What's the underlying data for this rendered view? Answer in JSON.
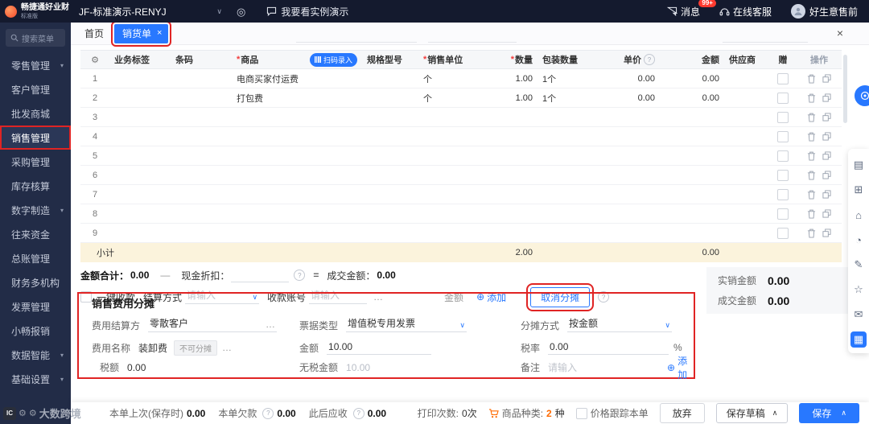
{
  "glyphs": {
    "gear": "⚙",
    "caret_down": "▾",
    "select_caret": "∨",
    "ellipsis": "…",
    "add": "⊕",
    "help": "?",
    "close": "×",
    "expand_up": "∧",
    "minus": "—",
    "equals": "=",
    "required": "*"
  },
  "topbar": {
    "logo_title": "畅捷通好业财",
    "logo_sub": "标准版",
    "org_select": "JF-标准演示-RENYJ",
    "demo_link": "我要看实例演示",
    "messages": {
      "label": "消息",
      "badge": "99+"
    },
    "support_label": "在线客服",
    "user_name": "好生意售前"
  },
  "sidebar": {
    "search_placeholder": "搜索菜单",
    "items": [
      {
        "label": "零售管理",
        "caret": true,
        "active": false,
        "annotated": false
      },
      {
        "label": "客户管理",
        "caret": false,
        "active": false,
        "annotated": false
      },
      {
        "label": "批发商城",
        "caret": false,
        "active": false,
        "annotated": false
      },
      {
        "label": "销售管理",
        "caret": false,
        "active": true,
        "annotated": true
      },
      {
        "label": "采购管理",
        "caret": false,
        "active": false,
        "annotated": false
      },
      {
        "label": "库存核算",
        "caret": false,
        "active": false,
        "annotated": false
      },
      {
        "label": "数字制造",
        "caret": true,
        "active": false,
        "annotated": false
      },
      {
        "label": "往来资金",
        "caret": false,
        "active": false,
        "annotated": false
      },
      {
        "label": "总账管理",
        "caret": false,
        "active": false,
        "annotated": false
      },
      {
        "label": "财务多机构",
        "caret": false,
        "active": false,
        "annotated": false
      },
      {
        "label": "发票管理",
        "caret": false,
        "active": false,
        "annotated": false
      },
      {
        "label": "小畅报销",
        "caret": false,
        "active": false,
        "annotated": false
      },
      {
        "label": "数据智能",
        "caret": true,
        "active": false,
        "annotated": false
      },
      {
        "label": "基础设置",
        "caret": true,
        "active": false,
        "annotated": false
      }
    ]
  },
  "tabs": {
    "home": "首页",
    "current": "销货单"
  },
  "grid": {
    "columns": [
      {
        "label": ""
      },
      {
        "label": "业务标签"
      },
      {
        "label": "条码"
      },
      {
        "label": "商品",
        "required": true,
        "scan_button": "扫码录入"
      },
      {
        "label": "规格型号"
      },
      {
        "label": "销售单位",
        "required": true
      },
      {
        "label": "数量",
        "required": true
      },
      {
        "label": "包装数量"
      },
      {
        "label": "单价",
        "info": true
      },
      {
        "label": "金额"
      },
      {
        "label": "供应商"
      },
      {
        "label": "赠"
      },
      {
        "label": "操作"
      }
    ],
    "rows": [
      {
        "rownum": "1",
        "product": "电商买家付运费",
        "unit": "个",
        "qty": "1.00",
        "pack": "1个",
        "price": "0.00",
        "amount": "0.00"
      },
      {
        "rownum": "2",
        "product": "打包费",
        "unit": "个",
        "qty": "1.00",
        "pack": "1个",
        "price": "0.00",
        "amount": "0.00"
      },
      {
        "rownum": "3"
      },
      {
        "rownum": "4"
      },
      {
        "rownum": "5"
      },
      {
        "rownum": "6"
      },
      {
        "rownum": "7"
      },
      {
        "rownum": "8"
      },
      {
        "rownum": "9"
      }
    ],
    "subtotal": {
      "label": "小计",
      "qty": "2.00",
      "amount": "0.00"
    }
  },
  "totals": {
    "amount_total_label": "金额合计：",
    "amount_total": "0.00",
    "cash_discount_label": "现金折扣：",
    "deal_amount_label": "成交金额：",
    "deal_amount": "0.00"
  },
  "payment": {
    "quick_receipt_label": "一键收款",
    "settle_method_label": "结算方式",
    "settle_method_placeholder": "请输入",
    "account_label": "收款账号",
    "account_placeholder": "请输入",
    "amount_label": "金额",
    "add_label": "添加",
    "cancel_allocation_label": "取消分摊"
  },
  "summary": {
    "actual_label": "实销金额",
    "actual_value": "0.00",
    "deal_label": "成交金额",
    "deal_value": "0.00"
  },
  "fee": {
    "title": "销售费用分摊",
    "payer_label": "费用结算方",
    "payer_value": "零散客户",
    "bill_type_label": "票据类型",
    "bill_type_value": "增值税专用发票",
    "allocate_label": "分摊方式",
    "allocate_value": "按金额",
    "fee_name_label": "费用名称",
    "fee_name_value": "装卸费",
    "fee_tag": "不可分摊",
    "amount_label": "金额",
    "amount_value": "10.00",
    "tax_rate_label": "税率",
    "tax_rate_value": "0.00",
    "percent": "%",
    "tax_label": "税额",
    "tax_value": "0.00",
    "net_label": "无税金额",
    "net_value": "10.00",
    "remark_label": "备注",
    "remark_placeholder": "请输入",
    "add_label": "添加"
  },
  "bottombar": {
    "last_saved_label": "本单上次(保存时)",
    "last_saved_value": "0.00",
    "debt_label": "本单欠款",
    "debt_value": "0.00",
    "receivable_label": "此后应收",
    "receivable_value": "0.00",
    "print_label": "打印次数:",
    "print_value": "0次",
    "sku_label": "商品种类:",
    "sku_value": "2",
    "sku_unit": "种",
    "price_track_label": "价格跟踪本单",
    "discard_label": "放弃",
    "save_draft_label": "保存草稿",
    "save_label": "保存"
  },
  "float": {
    "items": [
      {
        "name": "orders",
        "glyph": "▤"
      },
      {
        "name": "invoice",
        "glyph": "⊞"
      },
      {
        "name": "store",
        "glyph": "⌂"
      },
      {
        "name": "history",
        "glyph": "◔"
      },
      {
        "name": "edit",
        "glyph": "✎"
      },
      {
        "name": "favorite",
        "glyph": "☆"
      },
      {
        "name": "feedback",
        "glyph": "✉"
      },
      {
        "name": "panel",
        "glyph": "▦"
      }
    ]
  },
  "watermark": {
    "logo": "IC",
    "text": "大数跨境"
  }
}
